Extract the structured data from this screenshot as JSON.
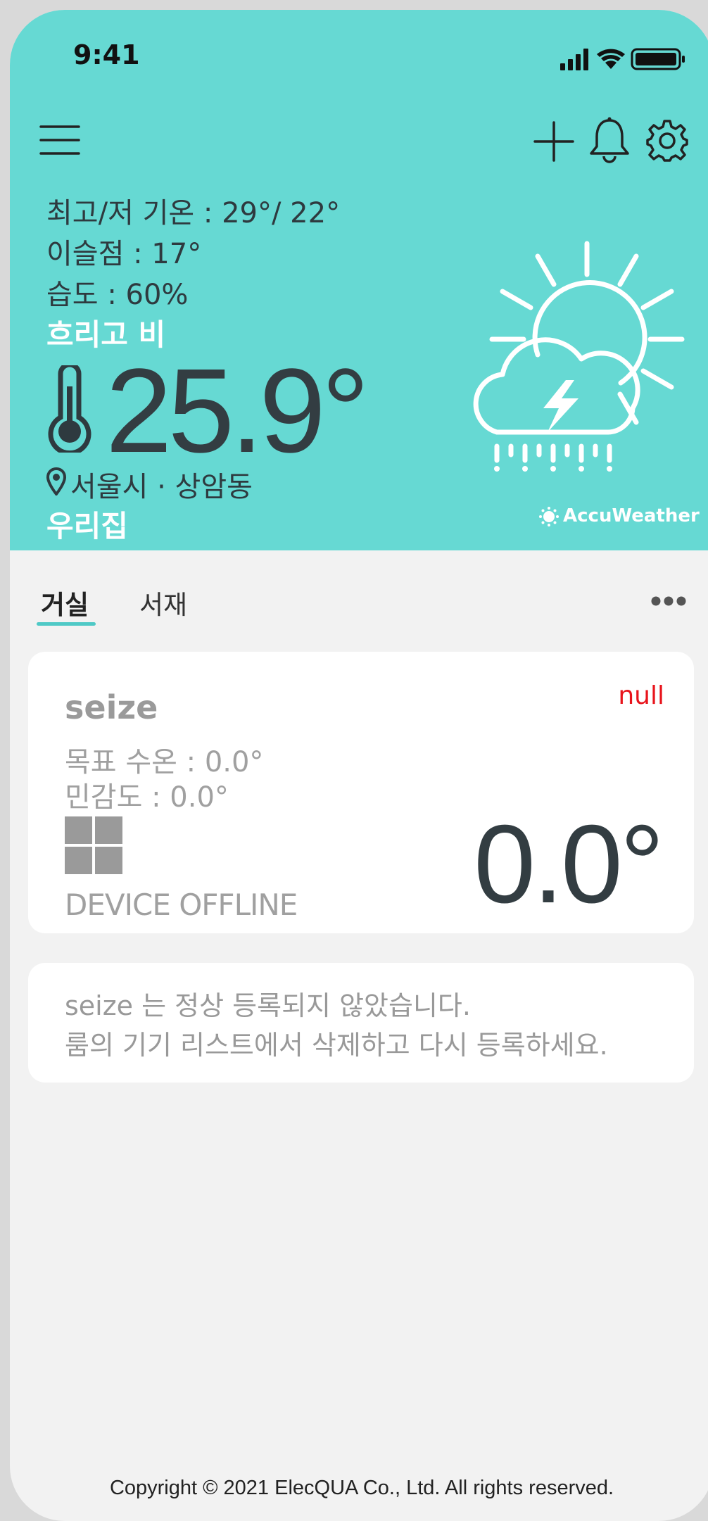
{
  "status_bar": {
    "time": "9:41"
  },
  "weather": {
    "high_low": "최고/저 기온 : 29°/ 22°",
    "dew_point": "이슬점 : 17°",
    "humidity": "습도 : 60%",
    "condition": "흐리고 비",
    "temperature": "25.9°",
    "location": "서울시 · 상암동",
    "home_name": "우리집",
    "provider": "AccuWeather",
    "icon": "sun-cloud-thunder-rain-icon"
  },
  "tabs": [
    {
      "label": "거실",
      "active": true
    },
    {
      "label": "서재",
      "active": false
    }
  ],
  "device": {
    "name": "seize",
    "status": "null",
    "target_temp": "목표 수온 : 0.0°",
    "sensitivity": "민감도 : 0.0°",
    "connection": "DEVICE OFFLINE",
    "current_temp": "0.0°"
  },
  "notice": {
    "line1": "seize 는 정상 등록되지 않았습니다.",
    "line2": "룸의 기기 리스트에서 삭제하고 다시 등록하세요."
  },
  "footer": {
    "copyright": "Copyright © 2021 ElecQUA Co., Ltd. All rights reserved."
  },
  "colors": {
    "header_bg": "#66d9d3",
    "accent": "#4fc9c6",
    "error": "#e8141c"
  }
}
